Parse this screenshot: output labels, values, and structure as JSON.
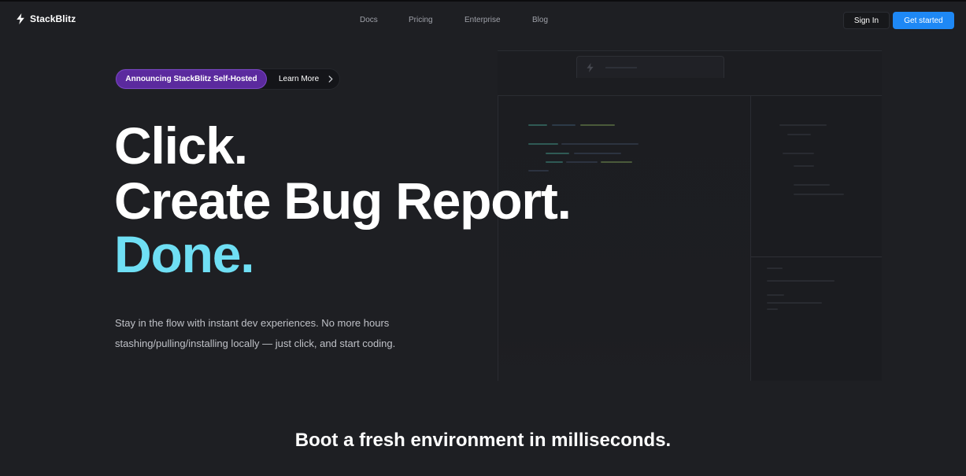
{
  "nav": {
    "brand": "StackBlitz",
    "links": [
      "Docs",
      "Pricing",
      "Enterprise",
      "Blog"
    ],
    "signin_label": "Sign In",
    "getstarted_label": "Get started"
  },
  "announcement": {
    "badge": "Announcing StackBlitz Self-Hosted",
    "link": "Learn More"
  },
  "hero": {
    "line1": "Click.",
    "line2": "Create Bug Report.",
    "line3": "Done.",
    "subtitle": "Stay in the flow with instant dev experiences. No more hours stashing/pulling/installing locally — just click, and start coding."
  },
  "boot": {
    "prefix": "Boot a fresh environment in ",
    "emphasis": "milliseconds."
  },
  "colors": {
    "background": "#1e1f23",
    "accent_blue": "#1e88f5",
    "announce_purple": "#5b2a9e",
    "done_cyan": "#6fdff4"
  },
  "icons": {
    "brand": "bolt-icon",
    "learn_more": "chevron-right-icon"
  }
}
